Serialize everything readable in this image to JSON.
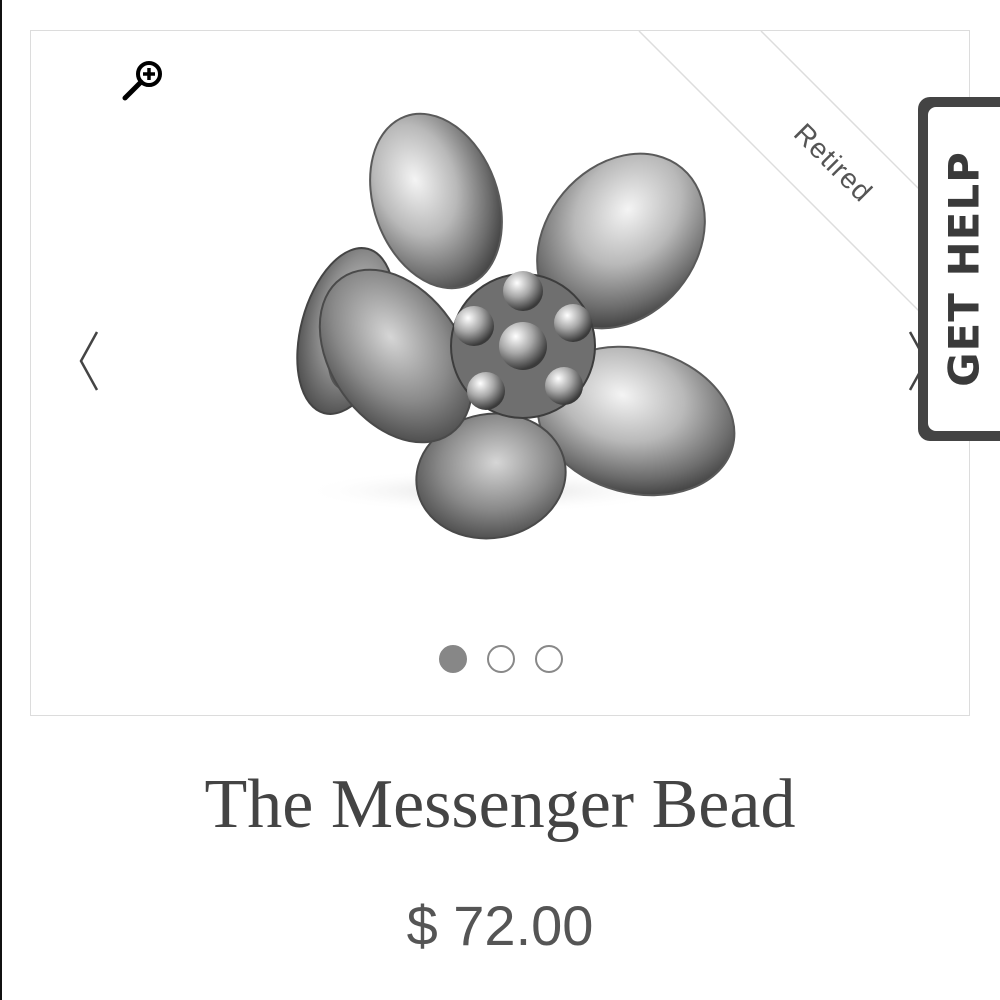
{
  "gallery": {
    "ribbon": "Retired",
    "slide_count": 3,
    "active_slide": 1
  },
  "help_tab": {
    "label": "GET HELP"
  },
  "product": {
    "title": "The Messenger Bead",
    "price": "$ 72.00"
  },
  "icons": {
    "zoom": "zoom-in-icon",
    "prev": "chevron-left-icon",
    "next": "chevron-right-icon"
  },
  "colors": {
    "text": "#444444",
    "dot_active": "#878787",
    "help_tab_frame": "#444444"
  }
}
